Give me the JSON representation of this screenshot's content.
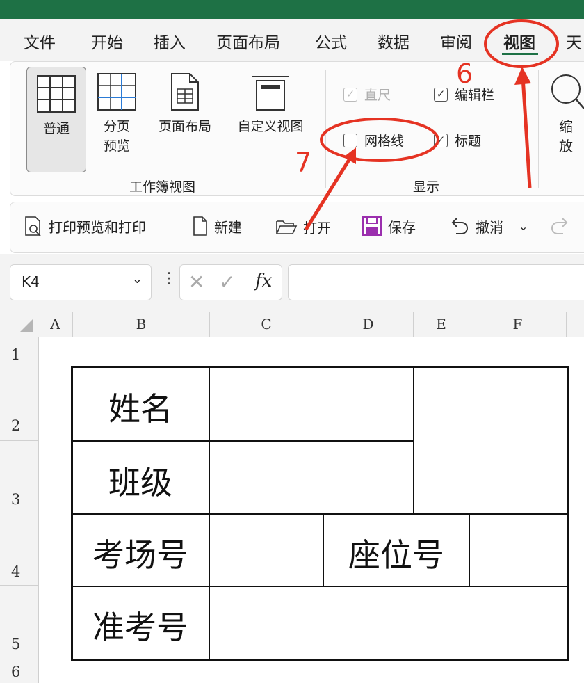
{
  "menu": {
    "items": [
      "文件",
      "开始",
      "插入",
      "页面布局",
      "公式",
      "数据",
      "审阅",
      "视图",
      "天"
    ],
    "active": "视图"
  },
  "ribbon": {
    "workbook_views": {
      "group_label": "工作簿视图",
      "buttons": [
        {
          "label": "普通",
          "selected": true
        },
        {
          "label": "分页\n预览",
          "selected": false
        },
        {
          "label": "页面布局",
          "selected": false
        },
        {
          "label": "自定义视图",
          "selected": false
        }
      ]
    },
    "show": {
      "group_label": "显示",
      "items": [
        {
          "label": "直尺",
          "checked": true,
          "disabled": true
        },
        {
          "label": "编辑栏",
          "checked": true,
          "disabled": false
        },
        {
          "label": "网格线",
          "checked": false,
          "disabled": false
        },
        {
          "label": "标题",
          "checked": true,
          "disabled": false
        }
      ]
    },
    "zoom": {
      "label": "缩\n放"
    }
  },
  "qat": {
    "items": [
      {
        "label": "打印预览和打印",
        "icon": "print-preview-icon"
      },
      {
        "label": "新建",
        "icon": "new-file-icon"
      },
      {
        "label": "打开",
        "icon": "open-folder-icon"
      },
      {
        "label": "保存",
        "icon": "save-icon"
      },
      {
        "label": "撤消",
        "icon": "undo-icon"
      }
    ]
  },
  "formula_bar": {
    "name_box": "K4",
    "fx": "fx",
    "content": ""
  },
  "sheet": {
    "columns": [
      "A",
      "B",
      "C",
      "D",
      "E",
      "F"
    ],
    "rows": [
      "1",
      "2",
      "3",
      "4",
      "5",
      "6"
    ],
    "cells": {
      "name_label": "姓名",
      "class_label": "班级",
      "exam_room_label": "考场号",
      "seat_label": "座位号",
      "ticket_label": "准考号"
    }
  },
  "annotations": {
    "step6": "6",
    "step7": "7"
  },
  "colors": {
    "brand_green": "#1e7145",
    "annotation_red": "#e53323"
  }
}
